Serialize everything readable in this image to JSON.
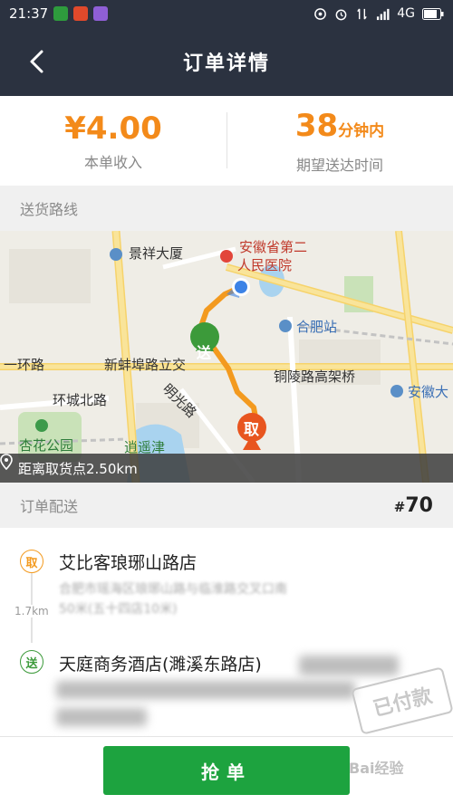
{
  "status_bar": {
    "time": "21:37",
    "network": "4G",
    "app_colors": [
      "#2e9b3d",
      "#e0492b",
      "#8f5fd6"
    ]
  },
  "header": {
    "title": "订单详情",
    "back_icon": "chevron-left-icon"
  },
  "summary": {
    "income_value": "¥4.00",
    "income_label": "本单收入",
    "eta_value": "38",
    "eta_unit": "分钟内",
    "eta_label": "期望送达时间",
    "accent_color": "#f38a1a"
  },
  "route_section": {
    "title": "送货路线"
  },
  "map": {
    "labels": {
      "jingxiang": "景祥大厦",
      "anhui_hospital_1": "安徽省第二",
      "anhui_hospital_2": "人民医院",
      "hefei_station": "合肥站",
      "ring_road": "一环路",
      "xinbengbu": "新蚌埠路立交",
      "mingguang": "明光路",
      "tongling": "铜陵路高架桥",
      "anhui_right": "安徽大",
      "huancheng": "环城北路",
      "xinghua": "杏花公园",
      "xiaoyaojin": "逍遥津"
    },
    "marker_send": "送",
    "marker_pickup": "取",
    "distance_text": "距离取货点2.50km"
  },
  "delivery_section": {
    "title": "订单配送",
    "order_number": "70"
  },
  "stops": {
    "pickup": {
      "badge": "取",
      "name": "艾比客琅琊山路店",
      "address_line1": "合肥市瑶海区琅琊山路与临淮路交叉口南",
      "address_line2": "50米(五十四店10米)"
    },
    "distance": "1.7km",
    "dropoff": {
      "badge": "送",
      "name": "天庭商务酒店(濉溪东路店)"
    }
  },
  "stamp": "已付款",
  "action": {
    "grab_label": "抢单",
    "color": "#1da33f"
  },
  "watermark": "Bai经验"
}
